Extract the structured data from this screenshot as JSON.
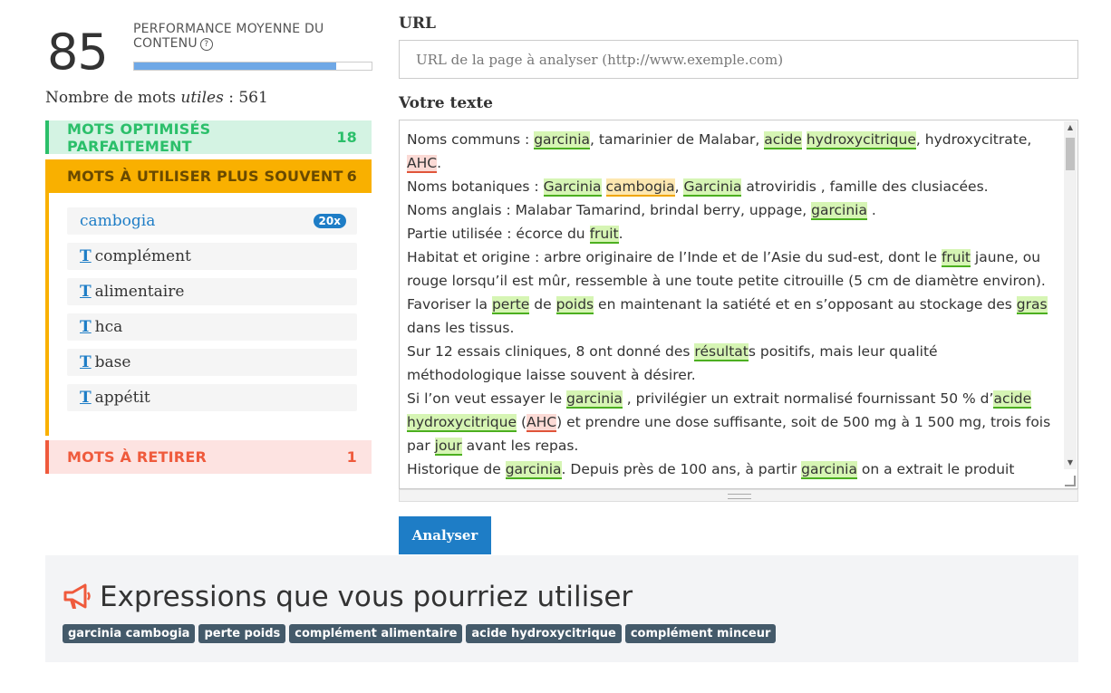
{
  "performance": {
    "score": "85",
    "label": "PERFORMANCE MOYENNE DU CONTENU",
    "help_glyph": "?",
    "progress": 0.85
  },
  "word_count": {
    "prefix": "Nombre de mots ",
    "emphasis": "utiles",
    "suffix": " : 561"
  },
  "categories": {
    "optimized": {
      "label": "MOTS OPTIMISÉS PARFAITEMENT",
      "count": "18"
    },
    "use_more": {
      "label": "MOTS À UTILISER PLUS SOUVENT",
      "count": "6"
    },
    "remove": {
      "label": "MOTS À RETIRER",
      "count": "1"
    }
  },
  "use_more_words": [
    {
      "word": "cambogia",
      "badge": "20x"
    },
    {
      "word": "complément",
      "icon": "T"
    },
    {
      "word": "alimentaire",
      "icon": "T"
    },
    {
      "word": "hca",
      "icon": "T"
    },
    {
      "word": "base",
      "icon": "T"
    },
    {
      "word": "appétit",
      "icon": "T"
    }
  ],
  "url": {
    "label": "URL",
    "placeholder": "URL de la page à analyser (http://www.exemple.com)"
  },
  "text": {
    "label": "Votre texte",
    "paragraphs": [
      [
        [
          "Noms communs : ",
          ""
        ],
        [
          "garcinia",
          "g"
        ],
        [
          ", tamarinier de Malabar, ",
          ""
        ],
        [
          "acide",
          "g"
        ],
        [
          " ",
          ""
        ],
        [
          "hydroxycitrique",
          "g"
        ],
        [
          ", hydroxycitrate, ",
          ""
        ],
        [
          "AHC",
          "r"
        ],
        [
          ".",
          ""
        ]
      ],
      [
        [
          "Noms botaniques : ",
          ""
        ],
        [
          "Garcinia",
          "g"
        ],
        [
          " ",
          ""
        ],
        [
          "cambogia",
          "o"
        ],
        [
          ", ",
          ""
        ],
        [
          "Garcinia",
          "g"
        ],
        [
          " atroviridis , famille des clusiacées.",
          ""
        ]
      ],
      [
        [
          "Noms anglais : Malabar Tamarind, brindal berry, uppage, ",
          ""
        ],
        [
          "garcinia",
          "g"
        ],
        [
          " .",
          ""
        ]
      ],
      [
        [
          "Partie utilisée : écorce du ",
          ""
        ],
        [
          "fruit",
          "g"
        ],
        [
          ".",
          ""
        ]
      ],
      [
        [
          "Habitat et origine : arbre originaire de l’Inde et de l’Asie du sud-est, dont le ",
          ""
        ],
        [
          "fruit",
          "g"
        ],
        [
          " jaune, ou rouge lorsqu’il est mûr, ressemble à une toute petite citrouille (5 cm de diamètre environ).",
          ""
        ]
      ],
      [
        [
          "Favoriser la ",
          ""
        ],
        [
          "perte",
          "g"
        ],
        [
          " de ",
          ""
        ],
        [
          "poids",
          "g"
        ],
        [
          " en maintenant la satiété et en s’opposant au stockage des ",
          ""
        ],
        [
          "gras",
          "g"
        ],
        [
          " dans les tissus.",
          ""
        ]
      ],
      [
        [
          "Sur 12 essais cliniques, 8 ont donné des ",
          ""
        ],
        [
          "résultat",
          "g"
        ],
        [
          "s positifs, mais leur qualité méthodologique laisse souvent à désirer.",
          ""
        ]
      ],
      [
        [
          "Si l’on veut essayer le ",
          ""
        ],
        [
          "garcinia",
          "g"
        ],
        [
          " , privilégier un extrait normalisé fournissant 50 % d’",
          ""
        ],
        [
          "acide",
          "g"
        ],
        [
          " ",
          ""
        ],
        [
          "hydroxycitrique",
          "g"
        ],
        [
          " (",
          ""
        ],
        [
          "AHC",
          "r"
        ],
        [
          ") et prendre une dose suffisante, soit de 500 mg à 1 500 mg, trois fois par ",
          ""
        ],
        [
          "jour",
          "g"
        ],
        [
          " avant les repas.",
          ""
        ]
      ],
      [
        [
          "Historique de ",
          ""
        ],
        [
          "garcinia",
          "g"
        ],
        [
          ". Depuis près de 100 ans, à partir ",
          ""
        ],
        [
          "garcinia",
          "g"
        ],
        [
          " on a extrait le produit",
          ""
        ]
      ]
    ]
  },
  "analyze_button": "Analyser",
  "expressions": {
    "title": "Expressions que vous pourriez utiliser",
    "tags": [
      "garcinia cambogia",
      "perte poids",
      "complément alimentaire",
      "acide hydroxycitrique",
      "complément minceur"
    ]
  },
  "colors": {
    "accent_blue": "#1e7dc6",
    "green": "#2bbf6a",
    "orange": "#f9b000",
    "red": "#ef5a3c",
    "tag_bg": "#445a6a"
  }
}
